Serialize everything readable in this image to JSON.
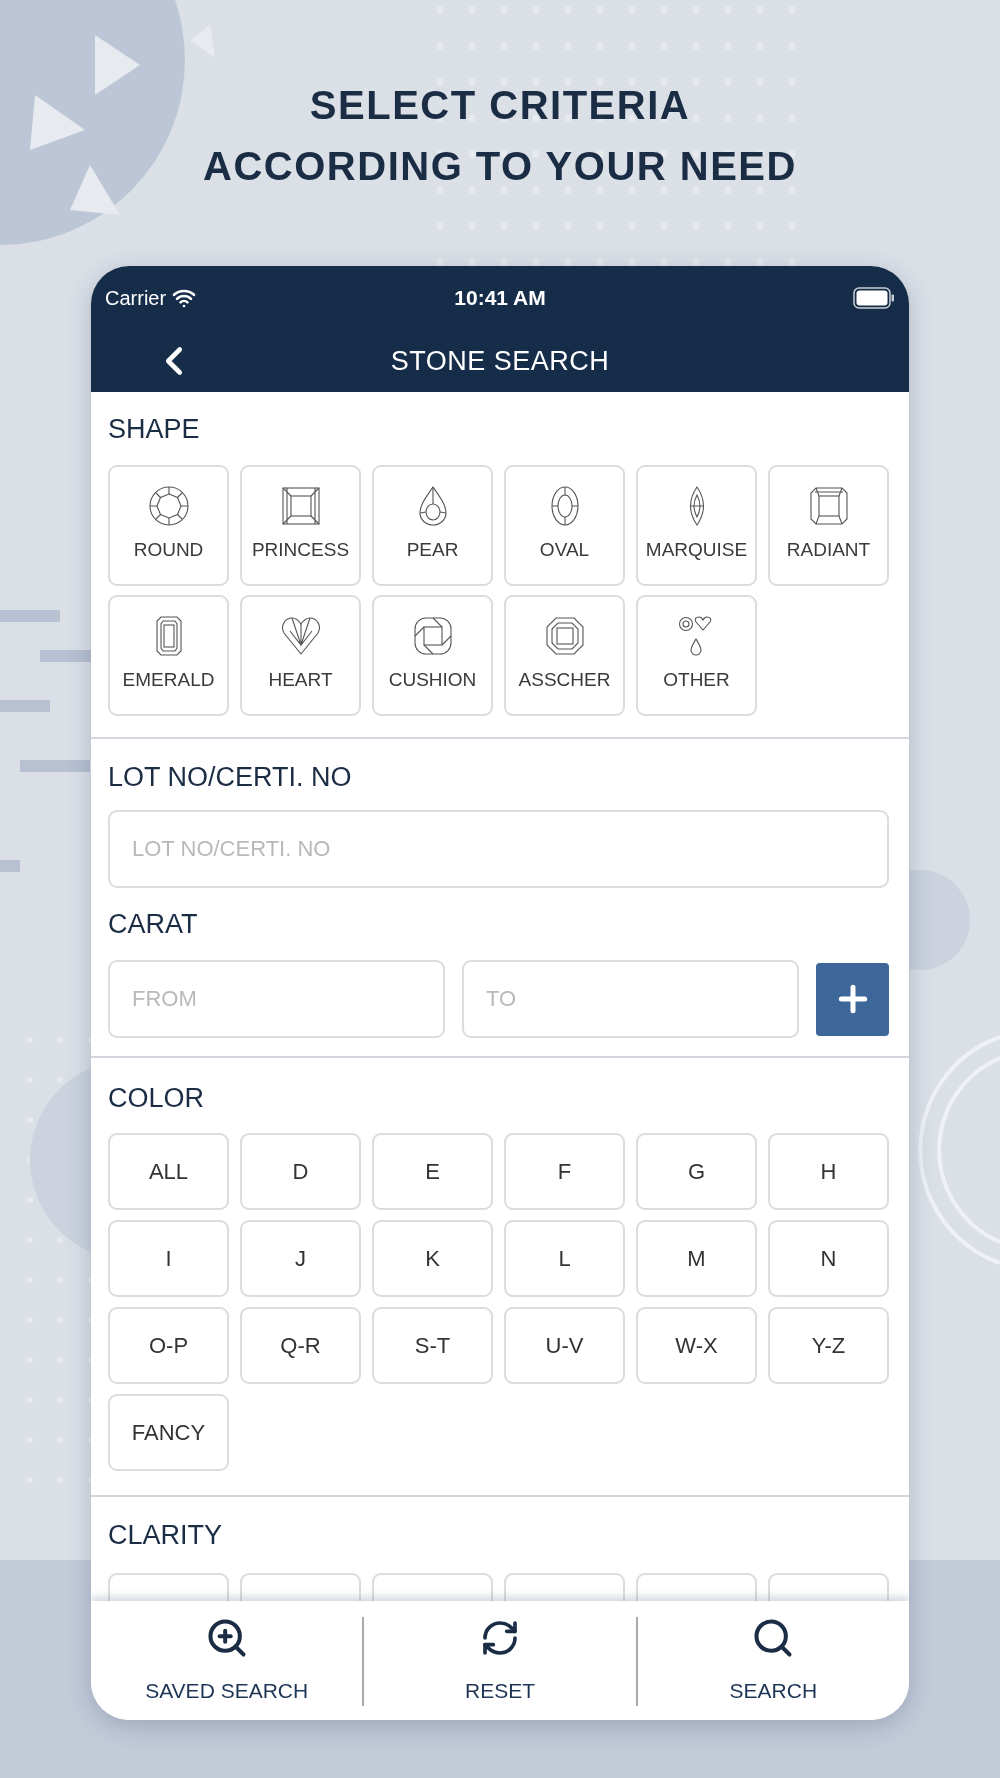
{
  "headline": "SELECT CRITERIA\nACCORDING TO YOUR NEED",
  "status_bar": {
    "carrier": "Carrier",
    "time": "10:41 AM"
  },
  "nav": {
    "title": "STONE SEARCH"
  },
  "shape": {
    "title": "SHAPE",
    "options": [
      {
        "label": "ROUND",
        "kind": "round"
      },
      {
        "label": "PRINCESS",
        "kind": "princess"
      },
      {
        "label": "PEAR",
        "kind": "pear"
      },
      {
        "label": "OVAL",
        "kind": "oval"
      },
      {
        "label": "MARQUISE",
        "kind": "marquise"
      },
      {
        "label": "RADIANT",
        "kind": "radiant"
      },
      {
        "label": "EMERALD",
        "kind": "emerald"
      },
      {
        "label": "HEART",
        "kind": "heart"
      },
      {
        "label": "CUSHION",
        "kind": "cushion"
      },
      {
        "label": "ASSCHER",
        "kind": "asscher"
      },
      {
        "label": "OTHER",
        "kind": "other"
      }
    ]
  },
  "lot": {
    "title": "LOT NO/CERTI. NO",
    "placeholder": "LOT NO/CERTI. NO"
  },
  "carat": {
    "title": "CARAT",
    "from_placeholder": "FROM",
    "to_placeholder": "TO"
  },
  "color": {
    "title": "COLOR",
    "options": [
      "ALL",
      "D",
      "E",
      "F",
      "G",
      "H",
      "I",
      "J",
      "K",
      "L",
      "M",
      "N",
      "O-P",
      "Q-R",
      "S-T",
      "U-V",
      "W-X",
      "Y-Z",
      "FANCY"
    ]
  },
  "clarity": {
    "title": "CLARITY",
    "options": [
      {
        "kind": "button"
      },
      {
        "kind": "button"
      },
      {
        "kind": "button"
      },
      {
        "kind": "button"
      },
      {
        "kind": "button"
      },
      {
        "kind": "button"
      }
    ]
  },
  "bottom_bar": [
    {
      "label": "SAVED SEARCH",
      "kind": "saved"
    },
    {
      "label": "RESET",
      "kind": "reset"
    },
    {
      "label": "SEARCH",
      "kind": "search"
    }
  ]
}
